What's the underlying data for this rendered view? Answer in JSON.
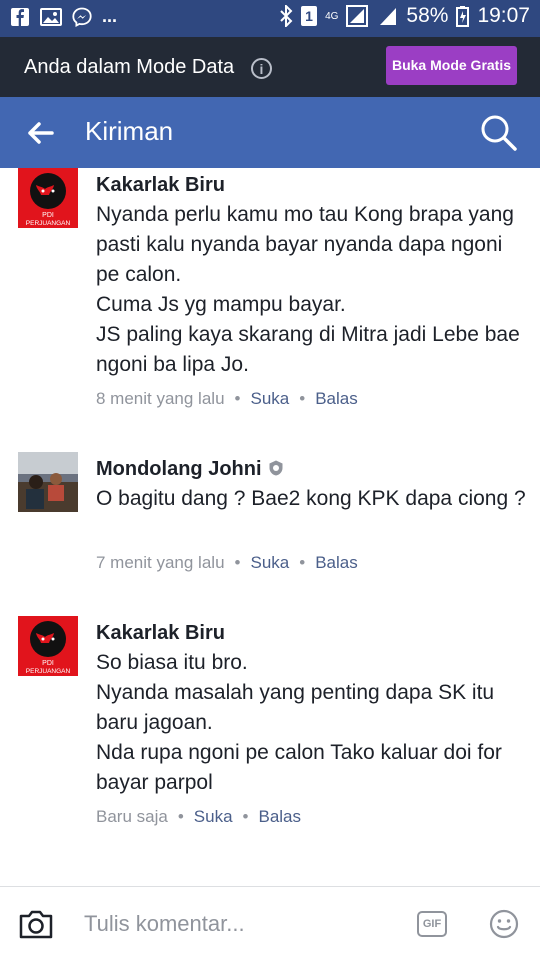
{
  "status_bar": {
    "network": "4G",
    "battery": "58%",
    "time": "19:07",
    "dots": "...",
    "sim": "1"
  },
  "data_mode": {
    "message": "Anda dalam Mode Data",
    "button_label": "Buka Mode Gratis",
    "button_color": "#9b3ec4"
  },
  "header": {
    "title": "Kiriman",
    "color": "#4267b2"
  },
  "comments": [
    {
      "author": "Kakarlak Biru",
      "avatar_text_1": "PDI",
      "avatar_text_2": "PERJUANGAN",
      "text": "Nyanda perlu kamu mo tau Kong brapa yang pasti kalu nyanda bayar nyanda dapa ngoni pe calon.\nCuma Js yg mampu bayar.\nJS paling kaya skarang di Mitra jadi Lebe bae ngoni ba lipa Jo.",
      "time": "8 menit yang lalu",
      "like": "Suka",
      "reply": "Balas"
    },
    {
      "author": "Mondolang Johni",
      "text": "O bagitu dang ? Bae2 kong KPK dapa ciong ?",
      "time": "7 menit yang lalu",
      "like": "Suka",
      "reply": "Balas"
    },
    {
      "author": "Kakarlak Biru",
      "avatar_text_1": "PDI",
      "avatar_text_2": "PERJUANGAN",
      "text": "So biasa itu bro.\nNyanda masalah yang penting dapa SK itu baru jagoan.\nNda rupa ngoni pe calon Tako kaluar doi for bayar parpol",
      "time": "Baru saja",
      "like": "Suka",
      "reply": "Balas"
    }
  ],
  "composer": {
    "placeholder": "Tulis komentar...",
    "gif_label": "GIF"
  },
  "icons": [
    "facebook-icon",
    "gallery-icon",
    "messenger-icon",
    "bluetooth-icon",
    "signal-icon",
    "battery-icon",
    "info-icon",
    "back-arrow-icon",
    "search-icon",
    "verified-badge-icon",
    "camera-icon",
    "gif-icon",
    "smiley-icon"
  ]
}
